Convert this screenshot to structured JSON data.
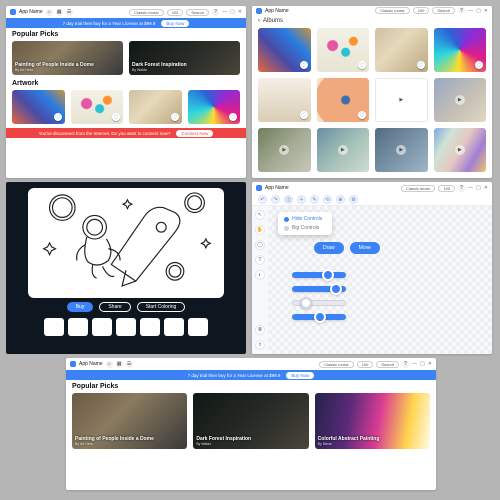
{
  "app_title": "App Name",
  "search_placeholder": "Search",
  "help_label": "?",
  "dropdown_label": "Classic music",
  "hundred_label": "100",
  "win_min": "—",
  "win_max": "▢",
  "win_close": "✕",
  "trial_banner": {
    "text": "7 day trial then buy for a Year License at $99.9",
    "button": "Buy Now"
  },
  "disconnect_banner": {
    "text": "You've disconnect from the Internet. Do you want to connect now?",
    "button": "Connect Now"
  },
  "sections": {
    "popular": "Popular Picks",
    "artwork": "Artwork",
    "albums": "Albums"
  },
  "cards": [
    {
      "title": "Painting of People Inside a Dome",
      "sub": "By Art Hero"
    },
    {
      "title": "Dark Forest Inspiration",
      "sub": "By Waldo"
    },
    {
      "title": "Colorful Abstract Painting",
      "sub": "By Steve"
    }
  ],
  "dark_actions": {
    "buy": "Buy",
    "share": "Share",
    "start": "Start Coloring"
  },
  "popover": {
    "item1": "Hide Controls",
    "item2": "Big Controls"
  },
  "tool_pills": {
    "a": "Draw",
    "b": "Move"
  },
  "editor_top_icons": [
    "↶",
    "↷",
    "⬚",
    "➕",
    "✎",
    "⟲",
    "⊕",
    "⚙"
  ]
}
